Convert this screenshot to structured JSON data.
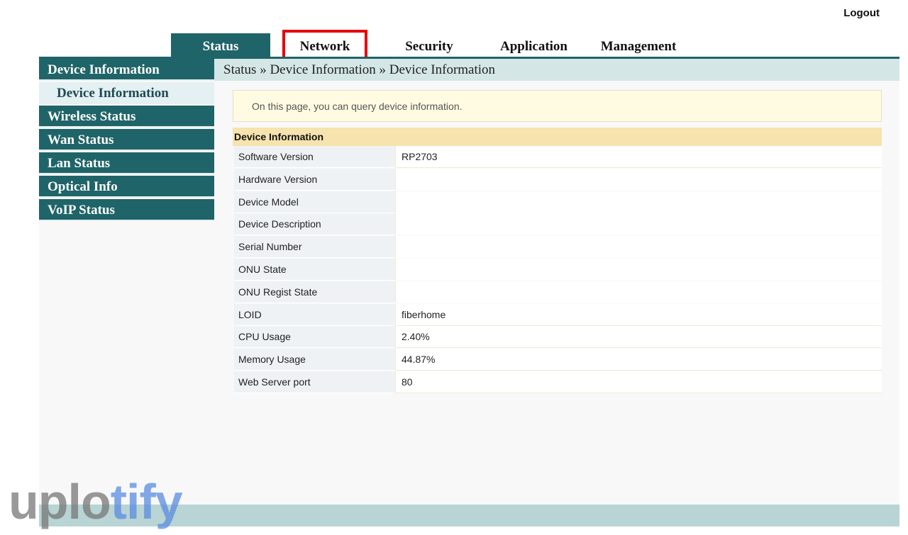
{
  "header": {
    "logout": "Logout"
  },
  "tabs": [
    {
      "label": "Status",
      "active": true
    },
    {
      "label": "Network",
      "highlighted": true
    },
    {
      "label": "Security"
    },
    {
      "label": "Application"
    },
    {
      "label": "Management"
    }
  ],
  "sidebar": {
    "items": [
      {
        "label": "Device Information",
        "type": "group"
      },
      {
        "label": "Device Information",
        "type": "sub",
        "active": true
      },
      {
        "label": "Wireless Status"
      },
      {
        "label": "Wan Status"
      },
      {
        "label": "Lan Status"
      },
      {
        "label": "Optical Info"
      },
      {
        "label": "VoIP Status"
      }
    ]
  },
  "breadcrumb": "Status » Device Information » Device Information",
  "note": "On this page, you can query device information.",
  "table": {
    "title": "Device Information",
    "rows": [
      {
        "label": "Software Version",
        "value": "RP2703"
      },
      {
        "label": "Hardware Version",
        "value": ""
      },
      {
        "label": "Device Model",
        "value": ""
      },
      {
        "label": "Device Description",
        "value": ""
      },
      {
        "label": "Serial Number",
        "value": ""
      },
      {
        "label": "ONU State",
        "value": ""
      },
      {
        "label": "ONU Regist State",
        "value": ""
      },
      {
        "label": "LOID",
        "value": "fiberhome"
      },
      {
        "label": "CPU Usage",
        "value": "2.40%"
      },
      {
        "label": "Memory Usage",
        "value": "44.87%"
      },
      {
        "label": "Web Server port",
        "value": "80"
      }
    ]
  },
  "watermark": {
    "part1": "uplo",
    "part2": "tify"
  },
  "colors": {
    "primary": "#1f6468",
    "highlight": "#e8000c"
  }
}
